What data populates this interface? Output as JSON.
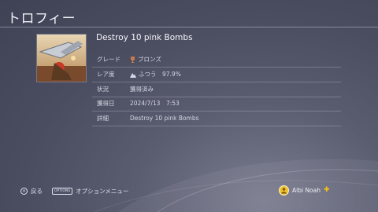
{
  "screen": {
    "title": "トロフィー"
  },
  "trophy": {
    "name": "Destroy 10 pink Bombs",
    "rows": [
      {
        "label": "グレード",
        "value": "ブロンズ",
        "icon": "bronze-trophy-icon"
      },
      {
        "label": "レア度",
        "value": "ふつう　97.9%",
        "icon": "rarity-icon"
      },
      {
        "label": "状況",
        "value": "獲得済み"
      },
      {
        "label": "獲得日",
        "value": "2024/7/13　7:53"
      },
      {
        "label": "詳細",
        "value": "Destroy 10 pink Bombs"
      }
    ]
  },
  "footer": {
    "back_button_glyph": "×",
    "back_label": "戻る",
    "options_button": "OPTIONS",
    "options_label": "オプションメニュー",
    "user_name": "Albi Noah",
    "plus_glyph": "✚"
  },
  "colors": {
    "bronze": "#c9794a",
    "plus": "#f5c21a",
    "avatar": "#f2c22e"
  }
}
